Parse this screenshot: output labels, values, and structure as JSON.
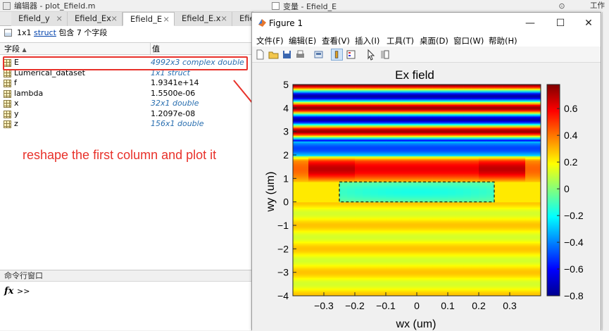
{
  "editor": {
    "title": "编辑器 - plot_Efield.m",
    "tabs": [
      {
        "label": "Efield_y",
        "close": "×"
      },
      {
        "label": "Efield_Ex",
        "close": "×"
      },
      {
        "label": "Efield_E",
        "close": "×"
      },
      {
        "label": "Efield_E.x",
        "close": "×"
      },
      {
        "label": "Efie",
        "close": ""
      }
    ],
    "struct_line": {
      "prefix": "1x1",
      "link": "struct",
      "suffix": "包含 7 个字段"
    },
    "columns": {
      "field": "字段",
      "value": "值"
    },
    "rows": [
      {
        "name": "E",
        "value": "4992x3 complex double",
        "italic": true
      },
      {
        "name": "Lumerical_dataset",
        "value": "1x1 struct",
        "italic": true
      },
      {
        "name": "f",
        "value": "1.9341e+14",
        "italic": false
      },
      {
        "name": "lambda",
        "value": "1.5500e-06",
        "italic": false
      },
      {
        "name": "x",
        "value": "32x1 double",
        "italic": true
      },
      {
        "name": "y",
        "value": "1.2097e-08",
        "italic": false
      },
      {
        "name": "z",
        "value": "156x1 double",
        "italic": true
      }
    ],
    "annotation": "reshape the first column and plot it",
    "annotation_color": "#e8312a",
    "command_window": {
      "title": "命令行窗口",
      "fx": "fx",
      "prompt": ">>"
    }
  },
  "variable_editor": {
    "title": "变量 - Efield_E",
    "workspace": "工作区"
  },
  "figure": {
    "title": "Figure 1",
    "window_buttons": {
      "minimize": "—",
      "maximize": "☐",
      "close": "✕"
    },
    "menu": [
      "文件(F)",
      "编辑(E)",
      "查看(V)",
      "插入(I)",
      "工具(T)",
      "桌面(D)",
      "窗口(W)",
      "帮助(H)"
    ],
    "tool_icons": [
      "new-icon",
      "open-icon",
      "save-icon",
      "print-icon",
      "link-icon",
      "colorbar-icon",
      "legend-icon",
      "pointer-icon",
      "property-icon"
    ]
  },
  "chart_data": {
    "type": "heatmap",
    "title": "Ex field",
    "xlabel": "wx (um)",
    "ylabel": "wy (um)",
    "xlim": [
      -0.4,
      0.4
    ],
    "ylim": [
      -4,
      5
    ],
    "xticks": [
      -0.3,
      -0.2,
      -0.1,
      0,
      0.1,
      0.2,
      0.3
    ],
    "yticks": [
      -4,
      -3,
      -2,
      -1,
      0,
      1,
      2,
      3,
      4,
      5
    ],
    "colorbar": {
      "clim": [
        -0.8,
        0.78
      ],
      "ticks": [
        -0.8,
        -0.6,
        -0.4,
        -0.2,
        0,
        0.2,
        0.4,
        0.6
      ],
      "colormap": "jet"
    },
    "waveguide_outline": {
      "x": [
        -0.25,
        0.25
      ],
      "y": [
        0,
        0.85
      ],
      "style": "dashed"
    }
  }
}
